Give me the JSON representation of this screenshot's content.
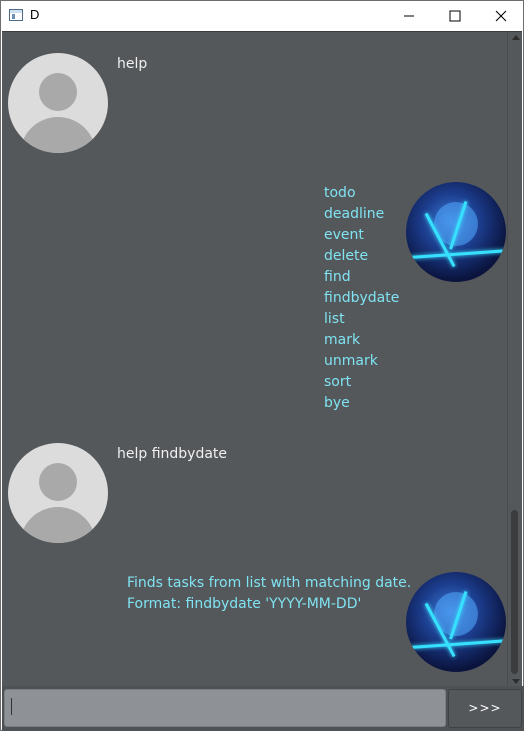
{
  "window": {
    "title": "D"
  },
  "conversation": [
    {
      "sender": "user",
      "text": "help"
    },
    {
      "sender": "bot",
      "lines": [
        "todo",
        "deadline",
        "event",
        "delete",
        "find",
        "findbydate",
        "list",
        "mark",
        "unmark",
        "sort",
        "bye"
      ]
    },
    {
      "sender": "user",
      "text": "help findbydate"
    },
    {
      "sender": "bot",
      "lines": [
        "Finds tasks from list with matching date.",
        "Format: findbydate 'YYYY-MM-DD'"
      ]
    }
  ],
  "input": {
    "value": "",
    "placeholder": ""
  },
  "send_button": {
    "label": ">>>"
  },
  "colors": {
    "chat_background": "#55585b",
    "bot_text": "#7fe3f2",
    "user_text": "#f0f0f0",
    "input_background": "#8e9296"
  },
  "icons": {
    "app": "window-icon",
    "minimize": "minimize-icon",
    "maximize": "maximize-icon",
    "close": "close-icon",
    "user_avatar": "user-avatar-icon",
    "bot_avatar": "bot-avatar-image"
  }
}
